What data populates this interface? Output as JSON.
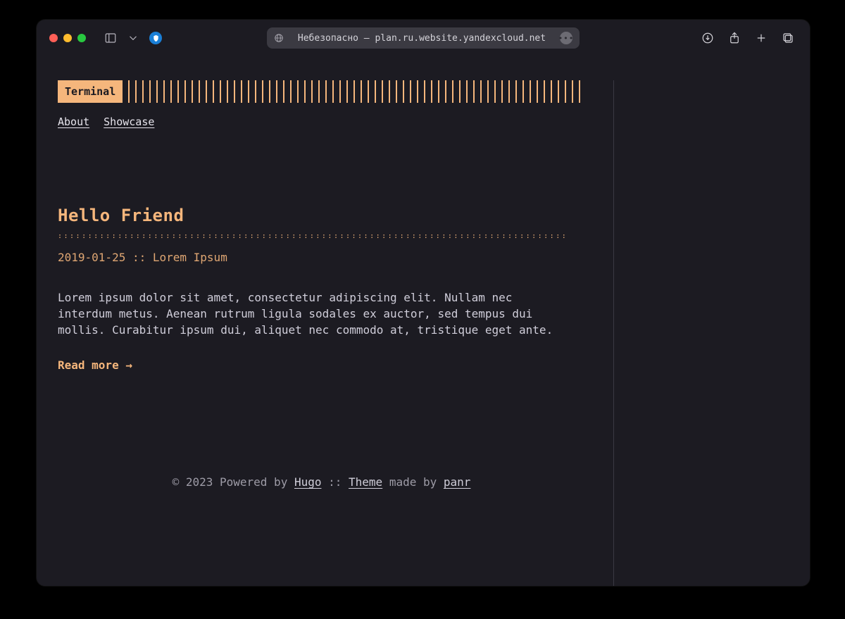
{
  "address_bar": {
    "label": "Небезопасно — plan.ru.website.yandexcloud.net"
  },
  "site": {
    "logo": "Terminal",
    "nav": [
      {
        "label": "About"
      },
      {
        "label": "Showcase"
      }
    ]
  },
  "post": {
    "title": "Hello Friend",
    "date": "2019-01-25",
    "sep": " :: ",
    "author": "Lorem Ipsum",
    "excerpt": "Lorem ipsum dolor sit amet, consectetur adipiscing elit. Nullam nec interdum metus. Aenean rutrum ligula sodales ex auctor, sed tempus dui mollis. Curabitur ipsum dui, aliquet nec commodo at, tristique eget ante.",
    "read_more": "Read more →"
  },
  "footer": {
    "copyright": "© 2023 Powered by ",
    "hugo": "Hugo",
    "sep": " :: ",
    "theme": "Theme",
    "made_by": " made by ",
    "panr": "panr"
  }
}
